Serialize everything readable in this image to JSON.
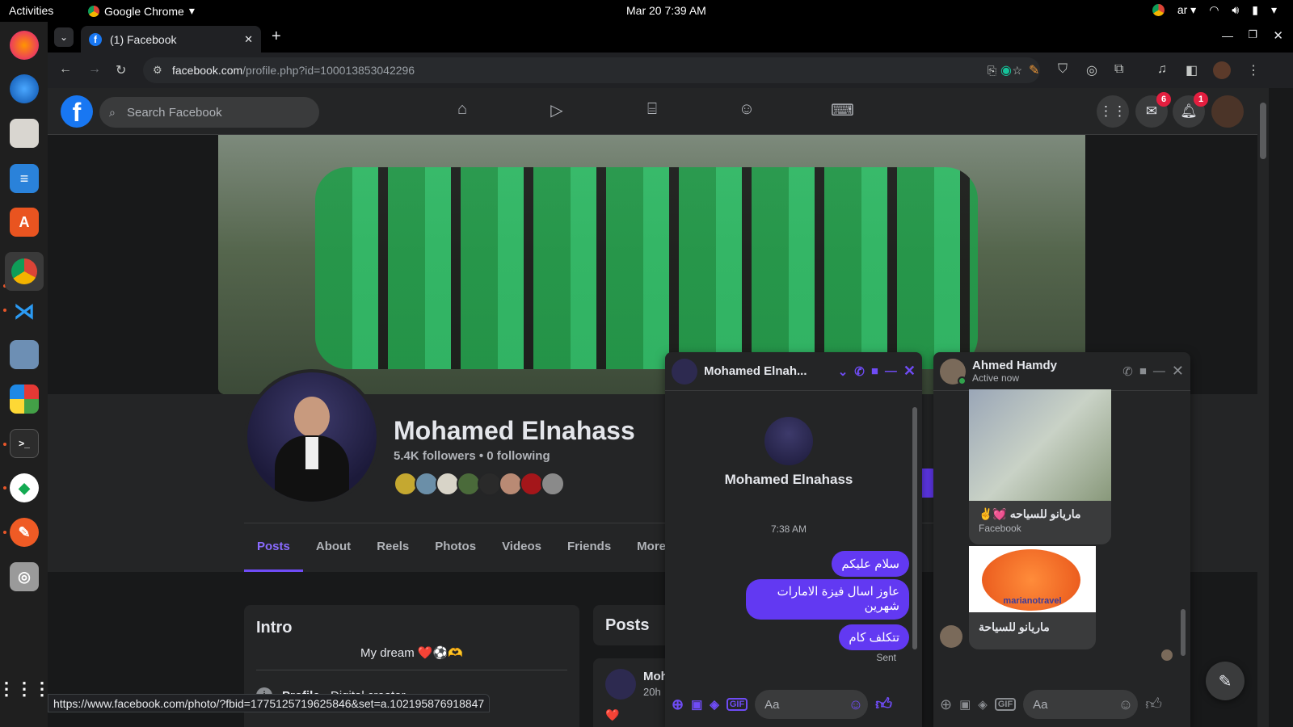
{
  "system_bar": {
    "activities": "Activities",
    "app_name": "Google Chrome",
    "clock": "Mar 20  7:39 AM",
    "keyboard_layout": "ar"
  },
  "browser": {
    "tab_title": "(1) Facebook",
    "url_host": "facebook.com",
    "url_path": "/profile.php?id=100013853042296",
    "status_url": "https://www.facebook.com/photo/?fbid=1775125719625846&set=a.102195876918847"
  },
  "facebook": {
    "search_placeholder": "Search Facebook",
    "messenger_badge": "6",
    "notifications_badge": "1",
    "profile": {
      "name": "Mohamed Elnahass",
      "stats": "5.4K followers • 0 following",
      "tabs": [
        "Posts",
        "About",
        "Reels",
        "Photos",
        "Videos",
        "Friends",
        "More"
      ]
    },
    "intro": {
      "title": "Intro",
      "bio": "My dream ❤️⚽🫶",
      "profile_label": "Profile",
      "profile_type": "Digital creator"
    },
    "posts": {
      "title": "Posts",
      "author_short": "Moh",
      "time": "20h",
      "reaction": "❤️"
    }
  },
  "chat1": {
    "title": "Mohamed Elnah...",
    "profile_name": "Mohamed Elnahass",
    "timestamp": "7:38 AM",
    "messages": [
      "سلام عليكم",
      "عاوز اسال فيزة الامارات شهرين",
      "تتكلف كام"
    ],
    "status": "Sent",
    "input_placeholder": "Aa"
  },
  "chat2": {
    "title": "Ahmed Hamdy",
    "subtitle": "Active now",
    "shared_post_1_title": "ماريانو للسياحه 💓✌️",
    "shared_post_1_source": "Facebook",
    "shared_post_2_logo": "marianotravel",
    "shared_post_2_title": "ماريانو للسياحة",
    "input_placeholder": "Aa"
  }
}
